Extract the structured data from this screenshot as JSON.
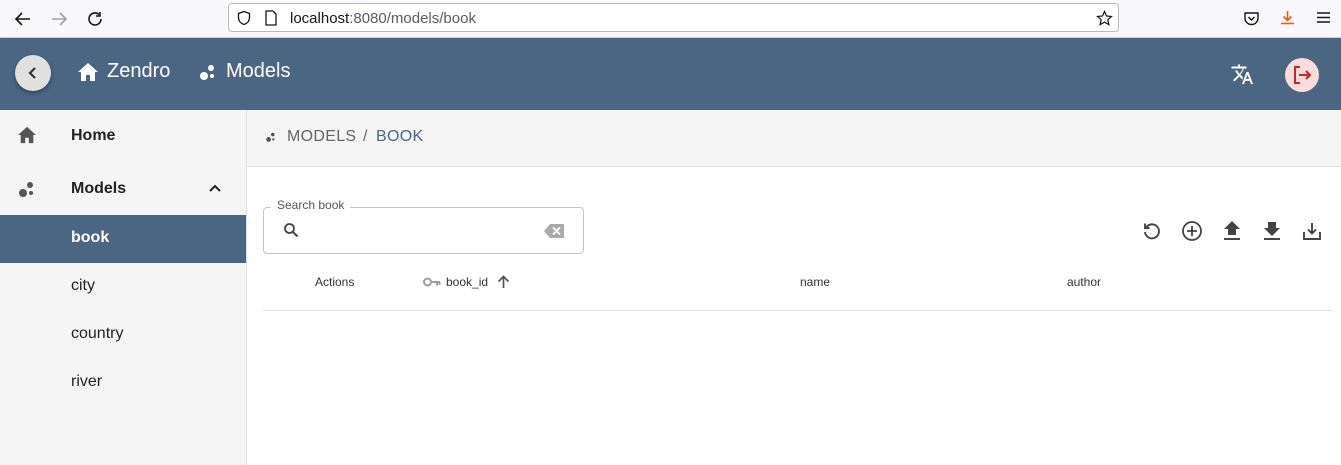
{
  "browser": {
    "url_host": "localhost",
    "url_rest": ":8080/models/book"
  },
  "header": {
    "home_label": "Zendro",
    "models_label": "Models"
  },
  "sidebar": {
    "home_label": "Home",
    "models_label": "Models",
    "models": [
      {
        "label": "book",
        "active": true
      },
      {
        "label": "city",
        "active": false
      },
      {
        "label": "country",
        "active": false
      },
      {
        "label": "river",
        "active": false
      }
    ]
  },
  "breadcrumb": {
    "models": "MODELS",
    "separator": "/",
    "current": "BOOK"
  },
  "search": {
    "label": "Search book",
    "value": "",
    "placeholder": ""
  },
  "table": {
    "columns": [
      "Actions",
      "book_id",
      "name",
      "author"
    ]
  },
  "colors": {
    "primary": "#4a6683",
    "logout_bg": "#fbdcdc",
    "logout_icon": "#c62828"
  }
}
